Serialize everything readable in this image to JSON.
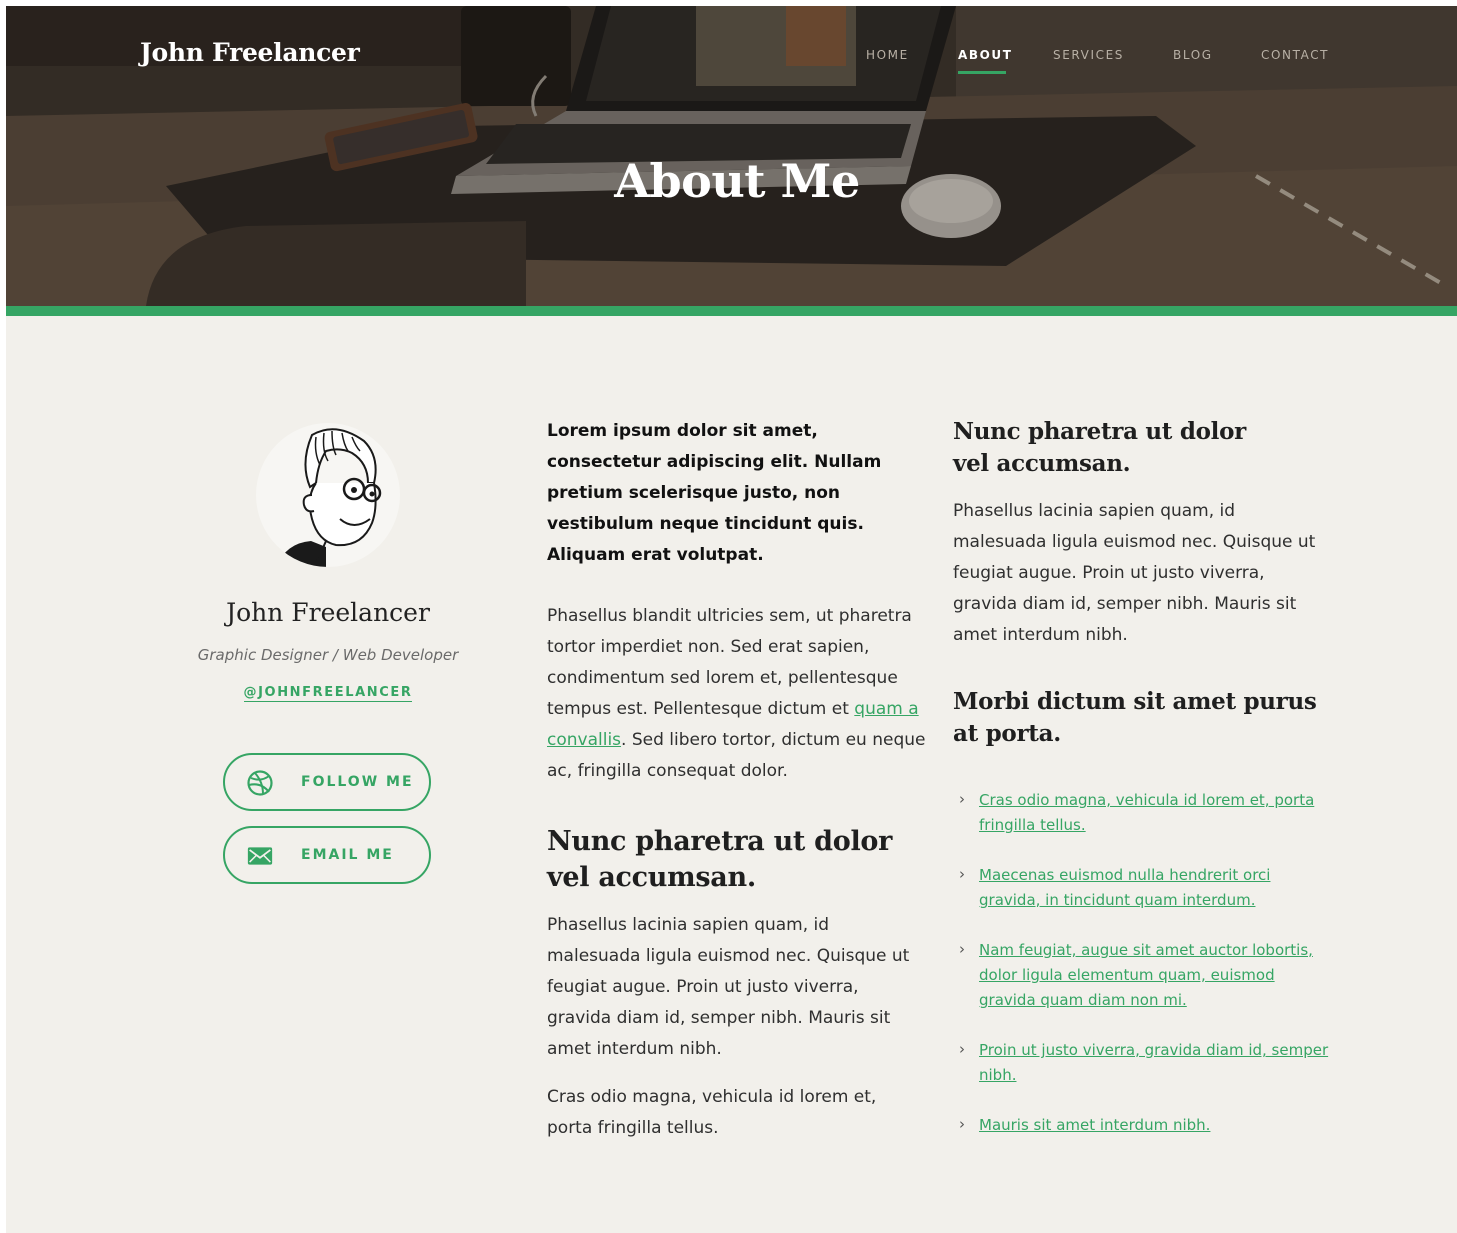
{
  "header": {
    "brand": "John Freelancer",
    "nav": [
      "HOME",
      "ABOUT",
      "SERVICES",
      "BLOG",
      "CONTACT"
    ],
    "active_nav": "ABOUT",
    "title": "About Me"
  },
  "profile": {
    "name": "John Freelancer",
    "role": "Graphic Designer / Web Developer",
    "handle": "@JOHNFREELANCER",
    "buttons": {
      "follow": "FOLLOW ME",
      "email": "EMAIL ME"
    }
  },
  "middle": {
    "lead": "Lorem ipsum dolor sit amet, consectetur adipiscing elit. Nullam pretium scelerisque justo, non vestibulum neque tincidunt quis. Aliquam erat volutpat.",
    "para1_before": "Phasellus blandit ultricies sem, ut pharetra tortor imperdiet non. Sed erat sapien, condimentum sed lorem et, pellentesque tempus est. Pellentesque dictum et ",
    "para1_link": "quam a convallis",
    "para1_after": ". Sed libero tortor, dictum eu neque ac, fringilla consequat dolor.",
    "heading": "Nunc pharetra ut dolor vel accumsan.",
    "para2": "Phasellus lacinia sapien quam, id malesuada ligula euismod nec. Quisque ut feugiat augue. Proin ut justo viverra, gravida diam id, semper nibh. Mauris sit amet interdum nibh.",
    "para3": "Cras odio magna, vehicula id lorem et, porta fringilla tellus."
  },
  "right": {
    "heading1": "Nunc pharetra ut dolor vel accumsan.",
    "para": "Phasellus lacinia sapien quam, id malesuada ligula euismod nec. Quisque ut feugiat augue. Proin ut justo viverra, gravida diam id, semper nibh. Mauris sit amet interdum nibh.",
    "heading2": "Morbi dictum sit amet purus at porta.",
    "links": [
      "Cras odio magna, vehicula id lorem et, porta fringilla tellus.",
      "Maecenas euismod nulla hendrerit orci gravida, in tincidunt quam interdum.",
      "Nam feugiat, augue sit amet auctor lobortis, dolor ligula elementum quam, euismod gravida quam diam non mi.",
      "Proin ut justo viverra, gravida diam id, semper nibh.",
      "Mauris sit amet interdum nibh."
    ]
  },
  "colors": {
    "accent": "#36a564",
    "background": "#f2f0eb",
    "hero_dark": "#3f3730",
    "text": "#2f2f2f"
  },
  "icons": {
    "follow": "dribbble-icon",
    "email": "envelope-icon",
    "list_bullet": "chevron-right-icon"
  }
}
